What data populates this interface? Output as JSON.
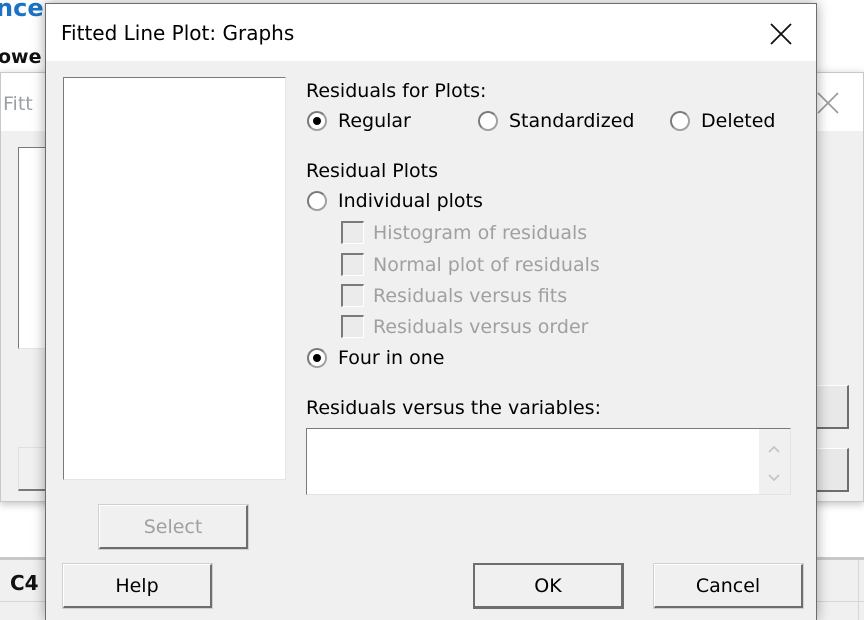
{
  "background": {
    "heading_fragment": "nce",
    "subheading_fragment": "owe",
    "dialog_title_fragment": "Fitt",
    "column_label": "C4"
  },
  "dialog": {
    "title": "Fitted Line Plot: Graphs",
    "close_icon": "close-icon",
    "residuals_for_plots": {
      "label": "Residuals for Plots:",
      "options": [
        {
          "label": "Regular",
          "checked": true
        },
        {
          "label": "Standardized",
          "checked": false
        },
        {
          "label": "Deleted",
          "checked": false
        }
      ]
    },
    "residual_plots": {
      "label": "Residual Plots",
      "individual_label": "Individual plots",
      "individual_checked": false,
      "checkboxes": [
        {
          "label": "Histogram of residuals",
          "checked": false,
          "enabled": false
        },
        {
          "label": "Normal plot of residuals",
          "checked": false,
          "enabled": false
        },
        {
          "label": "Residuals versus fits",
          "checked": false,
          "enabled": false
        },
        {
          "label": "Residuals versus order",
          "checked": false,
          "enabled": false
        }
      ],
      "four_in_one_label": "Four in one",
      "four_in_one_checked": true
    },
    "residuals_vs_variables": {
      "label": "Residuals versus the variables:",
      "value": ""
    },
    "buttons": {
      "select": "Select",
      "help": "Help",
      "ok": "OK",
      "cancel": "Cancel"
    }
  }
}
